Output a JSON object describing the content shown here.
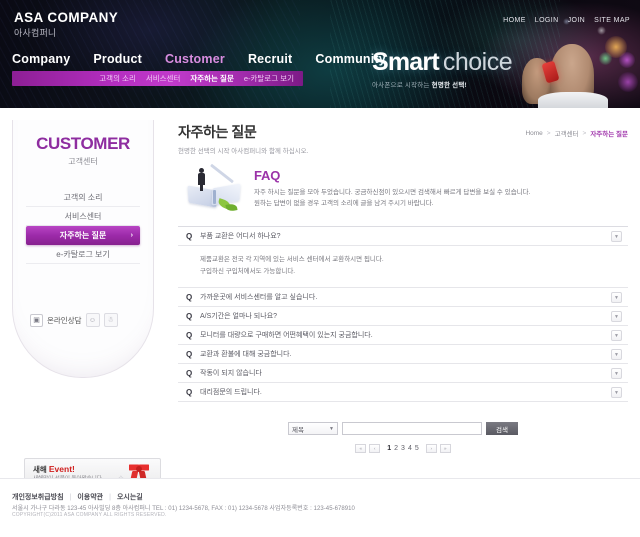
{
  "header": {
    "logo_en": "ASA COMPANY",
    "logo_kr": "아사컴퍼니",
    "topnav": [
      "HOME",
      "LOGIN",
      "JOIN",
      "SITE MAP"
    ],
    "gnb": [
      "Company",
      "Product",
      "Customer",
      "Recruit",
      "Community"
    ],
    "gnb_active": "Customer",
    "subnav": [
      "고객의 소리",
      "서비스센터",
      "자주하는 질문",
      "e-카탈로그 보기"
    ],
    "subnav_active": "자주하는 질문",
    "banner": {
      "title_bold": "Smart",
      "title_light": "choice",
      "subtitle_pre": "아사폰으로 시작하는 ",
      "subtitle_bold": "현명한 선택!"
    },
    "colors": {
      "accent": "#a33bae",
      "subnav_bg": "#b42ec0",
      "header_bg": "#0a0a14"
    }
  },
  "sidebar": {
    "title_en": "CUSTOMER",
    "title_kr": "고객센터",
    "items": [
      {
        "label": "고객의 소리",
        "active": false
      },
      {
        "label": "서비스센터",
        "active": false
      },
      {
        "label": "자주하는 질문",
        "active": true,
        "arrow": "›"
      },
      {
        "label": "e-카탈로그 보기",
        "active": false
      }
    ],
    "consult": {
      "icon": "monitor-icon",
      "label": "온라인상담",
      "buttons": [
        "user-pair-icon",
        "user-icon"
      ]
    },
    "event": {
      "kr": "새해 ",
      "en": "Event!",
      "desc": "새해맞이 선물이 돌아왔습니다",
      "icon": "gift-ribbon-icon"
    }
  },
  "main": {
    "page_title": "자주하는 질문",
    "page_subtitle": "현명한 선택의 시작 아사컴퍼니와 함께 하십시오.",
    "breadcrumb": {
      "home": "Home",
      "level1": "고객센터",
      "current": "자주하는 질문",
      "separator": ">"
    },
    "faq_intro": {
      "heading": "FAQ",
      "line1": "자주 하시는 질문을 모아 두었습니다. 궁금하신점이 있으시면 검색해서 빠르게 답변을 보실 수 있습니다.",
      "line2": "원하는 답변이 없을 경우 고객의 소리에 글을 남겨 주시기 바랍니다."
    },
    "q_marker": "Q",
    "toggle_icon": "chevron-down-icon",
    "faqs": [
      {
        "question": "부품 교환은 어디서 하나요?",
        "expanded": true,
        "answer_line1": "제품교환은 전국 각 지역에 있는 서비스 센터에서 교환하시면 됩니다.",
        "answer_line2": "구입하신 구입처에서도 가능합니다."
      },
      {
        "question": "가까운곳에 서비스센터를 알고 싶습니다.",
        "expanded": false
      },
      {
        "question": "A/S기간은 얼마나 되나요?",
        "expanded": false
      },
      {
        "question": "모니터를 대량으로 구매하면 어떤혜택이 있는지 궁금합니다.",
        "expanded": false
      },
      {
        "question": "교환과 환불에 대해 궁금합니다.",
        "expanded": false
      },
      {
        "question": "작동이 되지 않습니다",
        "expanded": false
      },
      {
        "question": "대리점문의 드립니다.",
        "expanded": false
      }
    ],
    "search": {
      "select_value": "제목",
      "select_icon": "caret-down-icon",
      "input_value": "",
      "input_placeholder": "",
      "button_label": "검색"
    },
    "pagination": {
      "first": "«",
      "prev": "‹",
      "next": "›",
      "last": "»",
      "pages": [
        "1",
        "2",
        "3",
        "4",
        "5"
      ],
      "current": "1"
    }
  },
  "footer": {
    "links": [
      "개인정보취급방침",
      "이용약관",
      "오시는길"
    ],
    "separator": "|",
    "address": "서울시 가나구 다라동 123-45 아사빌딩 8층 아사컴퍼니  TEL : 01) 1234-5678,  FAX : 01) 1234-5678  사업자등록번호 : 123-45-678910",
    "copyright": "COPYRIGHT(C)2011 ASA COMPANY ALL RIGHTS RESERVED."
  }
}
